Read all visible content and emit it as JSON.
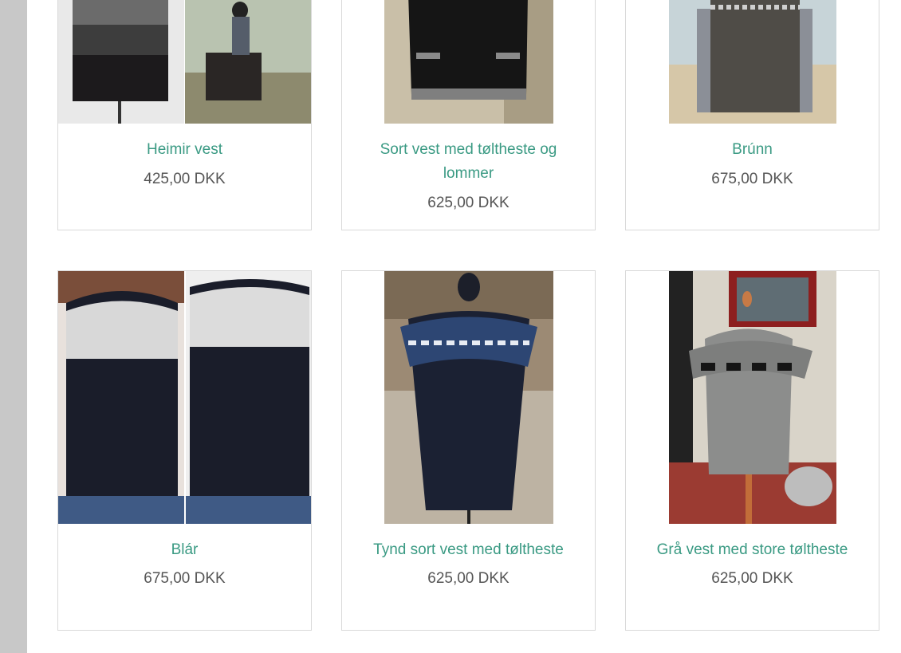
{
  "products": [
    {
      "name": "Heimir vest",
      "price": "425,00 DKK",
      "image": "heimir-vest-photo"
    },
    {
      "name": "Sort vest med tøltheste og lommer",
      "price": "625,00 DKK",
      "image": "sort-vest-photo"
    },
    {
      "name": "Brúnn",
      "price": "675,00 DKK",
      "image": "brunn-photo"
    },
    {
      "name": "Blár",
      "price": "675,00 DKK",
      "image": "blar-photo"
    },
    {
      "name": "Tynd sort vest med tøltheste",
      "price": "625,00 DKK",
      "image": "tynd-sort-vest-photo"
    },
    {
      "name": "Grå vest med store tøltheste",
      "price": "625,00 DKK",
      "image": "gra-vest-photo"
    }
  ],
  "colors": {
    "title": "#3a9a83",
    "price": "#555555",
    "border": "#d9d9d9",
    "sidebar": "#c8c8c8"
  }
}
